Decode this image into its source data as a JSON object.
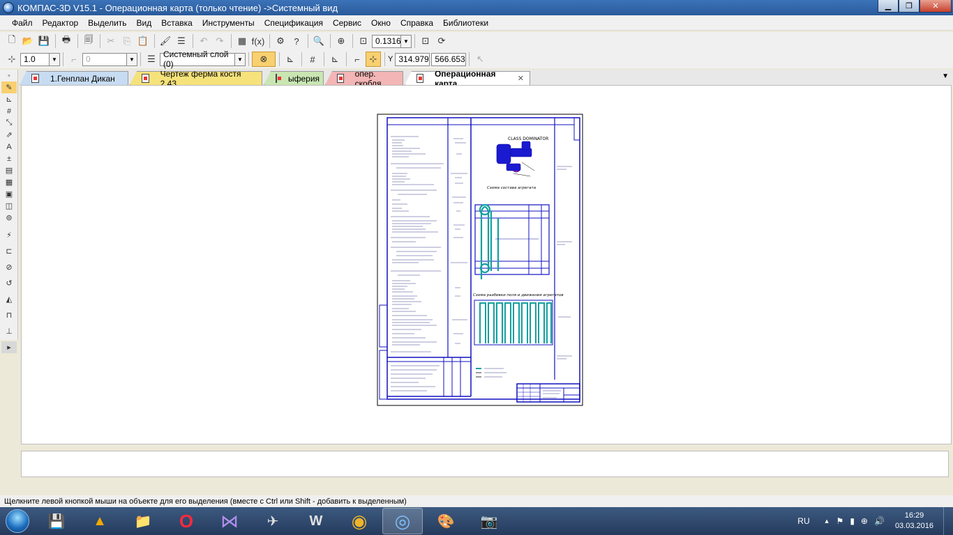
{
  "window": {
    "title": "КОМПАС-3D V15.1 - Операционная карта (только чтение) ->Системный вид",
    "minimize": "▁",
    "maximize": "❐",
    "close": "✕"
  },
  "menu": [
    "Файл",
    "Редактор",
    "Выделить",
    "Вид",
    "Вставка",
    "Инструменты",
    "Спецификация",
    "Сервис",
    "Окно",
    "Справка",
    "Библиотеки"
  ],
  "toolbar": {
    "zoom_value": "0.1316",
    "step_value": "1.0",
    "angle_value": "0",
    "layer_value": "Системный слой (0)",
    "coord_x": "314.979",
    "coord_y": "566.653",
    "coord_label": "Y",
    "icons": {
      "new": "🗋",
      "open": "📂",
      "save": "💾",
      "print": "🖶",
      "preview": "🗐",
      "cut": "✂",
      "copy": "⎘",
      "paste": "📋",
      "properties": "🖌",
      "list": "☰",
      "undo": "↶",
      "redo": "↷",
      "manager": "▦",
      "variables": "f(x)",
      "tools": "⚙",
      "help": "?",
      "zoom_window": "🔍",
      "zoom_in": "⊕",
      "zoom_fit": "⊡",
      "refresh": "⟳",
      "local_cs": "⁞",
      "snap": "⊹",
      "grid": "#",
      "ortho": "⊾",
      "round": "⌐",
      "magnet": "⊗",
      "cursor": "↖"
    }
  },
  "vtools": [
    "◦",
    "✎",
    "⊾",
    "#",
    "⤡",
    "⇗",
    "A",
    "±",
    "▤",
    "▦",
    "▣",
    "◫",
    "⊚",
    "⚡",
    "⊏",
    "⊘",
    "↺",
    "◭",
    "⊓",
    "⊥",
    "▸"
  ],
  "tabs": [
    {
      "label": "1.Генплан Дикан",
      "color": "#c7dcf2"
    },
    {
      "label": "Чертеж ферма костя 2,43",
      "color": "#f5e27a"
    },
    {
      "label": "ыферия",
      "color": "#c9e6b2"
    },
    {
      "label": "опер. скобля",
      "color": "#f3b5b5"
    },
    {
      "label": "Операционная карта",
      "color": "#ffffff",
      "active": true
    }
  ],
  "tab_close": "✕",
  "tab_scroll": "▼",
  "drawing": {
    "machine_label": "CLASS DOMINATOR",
    "scheme_label": "Схема состава агрегата",
    "movement_label": "Схема разбивки поля и движения агрегатов"
  },
  "status": {
    "hint": "Щелкните левой кнопкой мыши на объекте для его выделения (вместе с Ctrl или Shift - добавить к выделенным)"
  },
  "taskbar": {
    "apps": [
      {
        "name": "save-app",
        "glyph": "💾",
        "color": "#2b6fd8"
      },
      {
        "name": "archicad",
        "glyph": "▲",
        "color": "#f2a900"
      },
      {
        "name": "explorer",
        "glyph": "📁",
        "color": "#f4cf6a"
      },
      {
        "name": "opera",
        "glyph": "O",
        "color": "#e0001b"
      },
      {
        "name": "visual-studio",
        "glyph": "⋈",
        "color": "#7b57c7"
      },
      {
        "name": "world-of-warplanes",
        "glyph": "✈",
        "color": "#d8d8d8"
      },
      {
        "name": "world-of-tanks",
        "glyph": "W",
        "color": "#d8d8d8"
      },
      {
        "name": "chrome",
        "glyph": "◉",
        "color": "#e8453c"
      },
      {
        "name": "kompas",
        "glyph": "◎",
        "color": "#5aa0e6",
        "active": true
      },
      {
        "name": "paint",
        "glyph": "🎨",
        "color": "#e8c26a"
      },
      {
        "name": "camera",
        "glyph": "📷",
        "color": "#cccccc"
      }
    ],
    "lang": "RU",
    "tray_up": "▲",
    "tray_icons": [
      "⚑",
      "▮",
      "⊕",
      "🔊"
    ],
    "time": "16:29",
    "date": "03.03.2016"
  }
}
